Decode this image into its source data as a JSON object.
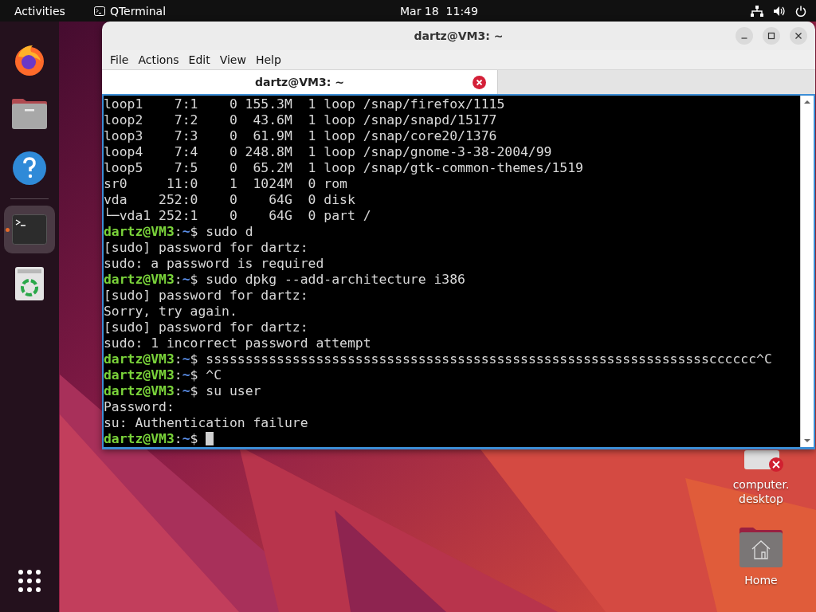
{
  "top_bar": {
    "activities": "Activities",
    "app_name": "QTerminal",
    "clock": "Mar 18  11:49"
  },
  "dock": [
    {
      "kind": "browser",
      "active": false
    },
    {
      "kind": "files",
      "active": false
    },
    {
      "kind": "help",
      "active": false
    },
    {
      "kind": "terminal",
      "active": true
    },
    {
      "kind": "trash",
      "active": false
    }
  ],
  "window": {
    "title": "dartz@VM3: ~",
    "menu": [
      "File",
      "Actions",
      "Edit",
      "View",
      "Help"
    ],
    "tabs": [
      {
        "label": "dartz@VM3: ~",
        "selected": true
      }
    ],
    "terminal": [
      {
        "kind": "output",
        "text": "loop1    7:1    0 155.3M  1 loop /snap/firefox/1115"
      },
      {
        "kind": "output",
        "text": "loop2    7:2    0  43.6M  1 loop /snap/snapd/15177"
      },
      {
        "kind": "output",
        "text": "loop3    7:3    0  61.9M  1 loop /snap/core20/1376"
      },
      {
        "kind": "output",
        "text": "loop4    7:4    0 248.8M  1 loop /snap/gnome-3-38-2004/99"
      },
      {
        "kind": "output",
        "text": "loop5    7:5    0  65.2M  1 loop /snap/gtk-common-themes/1519"
      },
      {
        "kind": "output",
        "text": "sr0     11:0    1  1024M  0 rom"
      },
      {
        "kind": "output",
        "text": "vda    252:0    0    64G  0 disk"
      },
      {
        "kind": "output",
        "text": "└─vda1 252:1    0    64G  0 part /"
      },
      {
        "kind": "prompt",
        "user": "dartz@VM3",
        "sep": ":",
        "path": "~",
        "sign": "$",
        "command": "sudo d"
      },
      {
        "kind": "output",
        "text": "[sudo] password for dartz:"
      },
      {
        "kind": "output",
        "text": "sudo: a password is required"
      },
      {
        "kind": "prompt",
        "user": "dartz@VM3",
        "sep": ":",
        "path": "~",
        "sign": "$",
        "command": "sudo dpkg --add-architecture i386"
      },
      {
        "kind": "output",
        "text": "[sudo] password for dartz:"
      },
      {
        "kind": "output",
        "text": "Sorry, try again."
      },
      {
        "kind": "output",
        "text": "[sudo] password for dartz:"
      },
      {
        "kind": "output",
        "text": "sudo: 1 incorrect password attempt"
      },
      {
        "kind": "prompt",
        "user": "dartz@VM3",
        "sep": ":",
        "path": "~",
        "sign": "$",
        "command": "sssssssssssssssssssssssssssssssssssssssssssssssssssssssssssssssscccccc^C"
      },
      {
        "kind": "prompt",
        "user": "dartz@VM3",
        "sep": ":",
        "path": "~",
        "sign": "$",
        "command": "^C"
      },
      {
        "kind": "prompt",
        "user": "dartz@VM3",
        "sep": ":",
        "path": "~",
        "sign": "$",
        "command": "su user"
      },
      {
        "kind": "output",
        "text": "Password:"
      },
      {
        "kind": "output",
        "text": "su: Authentication failure"
      },
      {
        "kind": "prompt",
        "user": "dartz@VM3",
        "sep": ":",
        "path": "~",
        "sign": "$",
        "cursor": true
      }
    ]
  },
  "desktop_icons": [
    {
      "kind": "broken-file",
      "label": "computer.\ndesktop"
    },
    {
      "kind": "home",
      "label": "Home"
    }
  ]
}
